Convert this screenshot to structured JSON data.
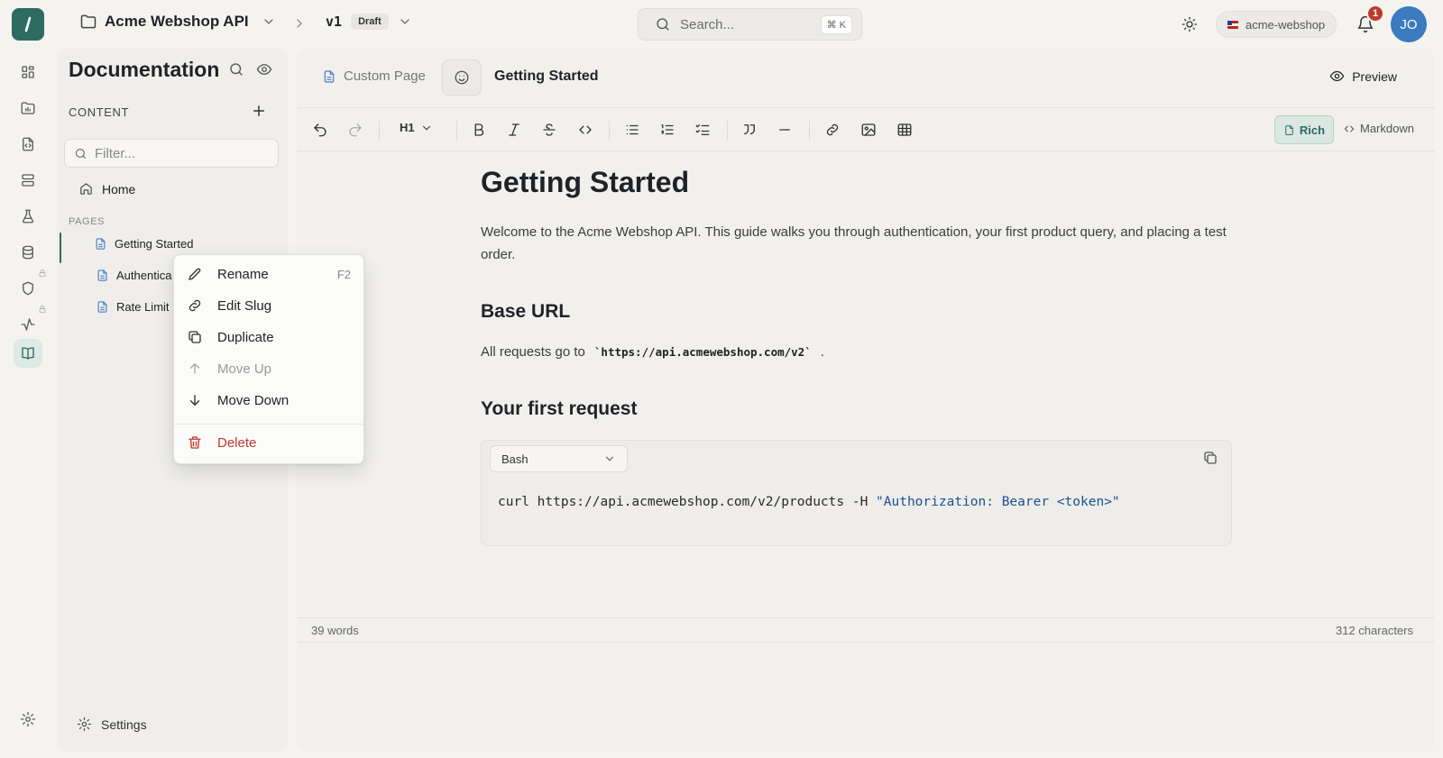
{
  "topbar": {
    "project_name": "Acme Webshop API",
    "version": "v1",
    "version_badge": "Draft",
    "search_placeholder": "Search...",
    "search_shortcut": "⌘ K",
    "workspace": "acme-webshop",
    "notification_count": "1",
    "avatar_initials": "JO"
  },
  "sidebar": {
    "title": "Documentation",
    "content_label": "CONTENT",
    "filter_placeholder": "Filter...",
    "home": "Home",
    "pages_label": "PAGES",
    "pages": [
      {
        "label": "Getting Started",
        "active": true
      },
      {
        "label": "Authentica"
      },
      {
        "label": "Rate Limit"
      }
    ],
    "settings": "Settings"
  },
  "rail": {
    "icons": [
      "dashboard-icon",
      "folder-chart-icon",
      "file-code-icon",
      "server-icon",
      "flask-icon",
      "database-icon",
      "shield-icon",
      "activity-icon",
      "book-icon",
      "settings-icon"
    ],
    "active": "book-icon"
  },
  "editor_header": {
    "tab_type": "Custom Page",
    "page_title": "Getting Started",
    "preview": "Preview"
  },
  "toolbar": {
    "heading": "H1",
    "mode_rich": "Rich",
    "mode_markdown": "Markdown"
  },
  "document": {
    "h1": "Getting Started",
    "intro": "Welcome to the Acme Webshop API. This guide walks you through authentication, your first product query, and placing a test order.",
    "h2_base": "Base URL",
    "base_text": "All requests go to",
    "base_url": "`https://api.acmewebshop.com/v2`",
    "base_tail": ".",
    "h2_first": "Your first request",
    "code_language": "Bash",
    "code_cmd": "curl https://api.acmewebshop.com/v2/products -H ",
    "code_string": "\"Authorization: Bearer <token>\""
  },
  "status": {
    "words": "39 words",
    "characters": "312 characters"
  },
  "context_menu": {
    "rename": "Rename",
    "rename_key": "F2",
    "edit_slug": "Edit Slug",
    "duplicate": "Duplicate",
    "move_up": "Move Up",
    "move_down": "Move Down",
    "delete": "Delete"
  },
  "colors": {
    "accent": "#2e6b60",
    "danger": "#c0392b",
    "page_icon": "#4a7dc9"
  }
}
